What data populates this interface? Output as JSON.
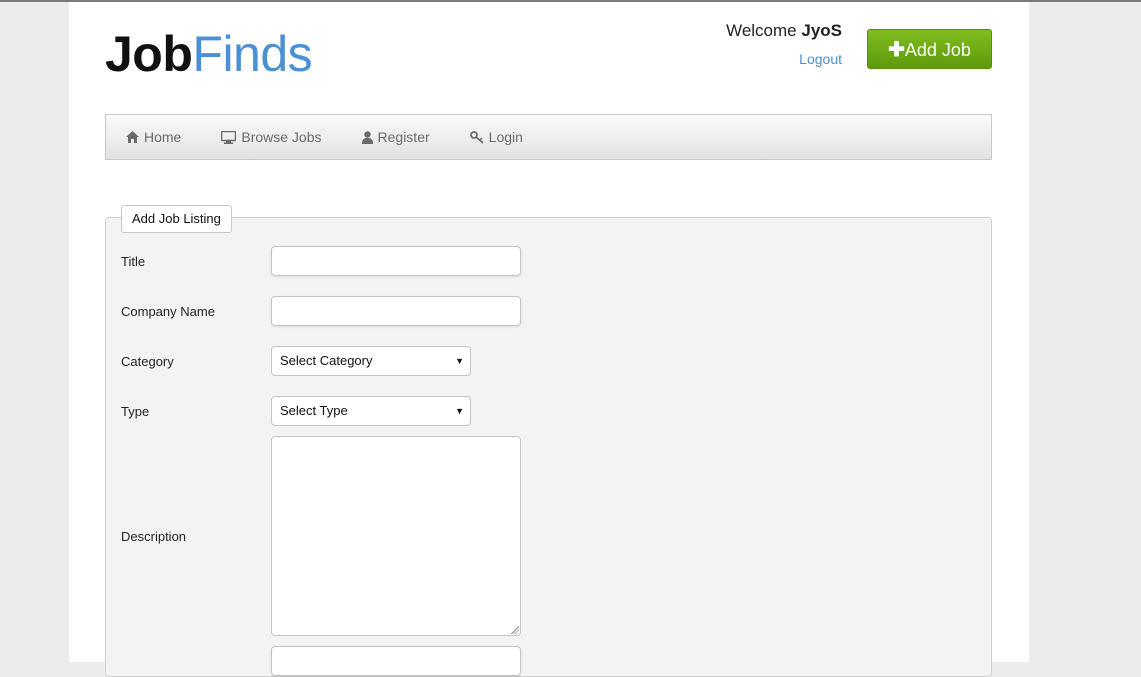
{
  "brand": {
    "part1": "Job",
    "part2": "Finds"
  },
  "header": {
    "welcome_prefix": "Welcome",
    "username": "JyoS",
    "logout_label": "Logout",
    "add_job_label": "Add Job"
  },
  "nav": {
    "items": [
      {
        "label": "Home",
        "icon": "home-icon"
      },
      {
        "label": "Browse Jobs",
        "icon": "monitor-icon"
      },
      {
        "label": "Register",
        "icon": "user-icon"
      },
      {
        "label": "Login",
        "icon": "key-icon"
      }
    ]
  },
  "form": {
    "legend": "Add Job Listing",
    "title_label": "Title",
    "title_value": "",
    "company_label": "Company Name",
    "company_value": "",
    "category_label": "Category",
    "category_selected": "Select Category",
    "type_label": "Type",
    "type_selected": "Select Type",
    "description_label": "Description",
    "description_value": ""
  },
  "colors": {
    "brand_blue": "#4a90d2",
    "add_button_green": "#6aab14",
    "link_blue": "#4a90d2"
  }
}
